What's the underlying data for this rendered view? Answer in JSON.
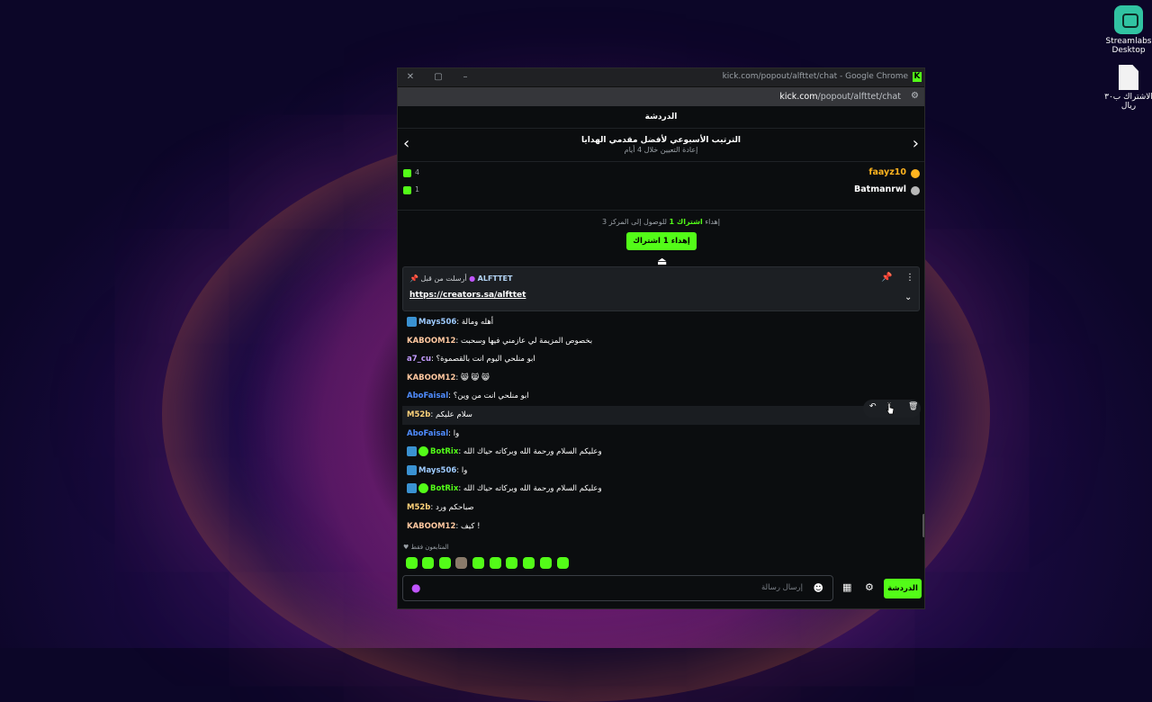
{
  "desktop": {
    "icons": [
      {
        "label_line1": "Streamlabs",
        "label_line2": "Desktop",
        "icon": "streamlabs-icon"
      },
      {
        "label_line1": "الاشتراك ب٣٠",
        "label_line2": "ريال",
        "icon": "file-icon"
      }
    ]
  },
  "browser": {
    "window_title": "kick.com/popout/alfttet/chat - Google Chrome",
    "url_host": "kick.com",
    "url_path": "/popout/alfttet/chat"
  },
  "chat": {
    "header": "الدردشة",
    "leaderboard": {
      "title": "الترتيب الأسبوعي لأفضل مقدمي الهدايا",
      "subtitle": "إعادة التعيين خلال 4 أيام",
      "rows": [
        {
          "name": "faayz10",
          "count": "4",
          "color": "#ffb41f"
        },
        {
          "name": "Batmanrwl",
          "count": "1",
          "color": "#ffffff"
        }
      ]
    },
    "sub_goal": {
      "text": "للوصول إلى المركز 3",
      "highlight": "اشتراك 1",
      "suffix": "إهداء",
      "gift_button": "إهداء 1 اشتراك"
    },
    "pinned": {
      "user": "ALFTTET",
      "label": "أرسلت من قبل",
      "link": "https://creators.sa/alfttet"
    },
    "messages": [
      {
        "user": "Mays506",
        "color": "#9ecbff",
        "text": "أهله ومالة",
        "badges": [
          "sub"
        ]
      },
      {
        "user": "KABOOM12",
        "color": "#ffc8a0",
        "text": "بخصوص المزيمة لي عازمني فيها وسحبت",
        "badges": []
      },
      {
        "user": "a7_cu",
        "color": "#c39bff",
        "text": "ابو منلحي اليوم انت بالقصموة؟",
        "badges": []
      },
      {
        "user": "KABOOM12",
        "color": "#ffc8a0",
        "text": "😸 😸 😸",
        "badges": []
      },
      {
        "user": "AboFaisal",
        "color": "#4f8cff",
        "text": "ابو منلحي انت من وين؟",
        "badges": []
      },
      {
        "user": "M52b",
        "color": "#ffd27a",
        "text": "سلام عليكم",
        "badges": [],
        "highlight": true
      },
      {
        "user": "AboFaisal",
        "color": "#4f8cff",
        "text": "وا",
        "badges": []
      },
      {
        "user": "BotRix",
        "color": "#53fc18",
        "text": "وعليكم السلام ورحمة الله وبركاته حياك الله",
        "badges": [
          "sub",
          "verified"
        ]
      },
      {
        "user": "Mays506",
        "color": "#9ecbff",
        "text": "وا",
        "badges": [
          "sub"
        ]
      },
      {
        "user": "BotRix",
        "color": "#53fc18",
        "text": "وعليكم السلام ورحمة الله وبركاته حياك الله",
        "badges": [
          "sub",
          "verified"
        ]
      },
      {
        "user": "M52b",
        "color": "#ffd27a",
        "text": "صباحكم ورد",
        "badges": []
      },
      {
        "user": "KABOOM12",
        "color": "#ffc8a0",
        "text": "كيف !",
        "badges": []
      }
    ],
    "emote_section_label": "المتابعون فقط",
    "input_placeholder": "إرسال رسالة",
    "send_button": "الدردشة"
  },
  "colors": {
    "accent": "#53fc18",
    "bg": "#0b0d0f"
  }
}
